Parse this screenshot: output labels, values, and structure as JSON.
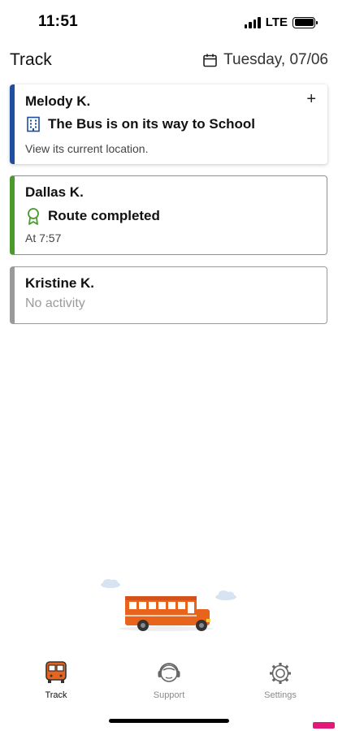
{
  "status_bar": {
    "time": "11:51",
    "network": "LTE"
  },
  "header": {
    "title": "Track",
    "date": "Tuesday, 07/06",
    "date_icon": "calendar-icon"
  },
  "cards": [
    {
      "name": "Melody K.",
      "status_icon": "building-icon",
      "headline": "The Bus is on its way to School",
      "detail": "View its current location.",
      "action": "+",
      "accent": "#1f4e9e"
    },
    {
      "name": "Dallas K.",
      "status_icon": "award-icon",
      "headline": "Route completed",
      "detail": "At 7:57",
      "accent": "#4a9a2c"
    },
    {
      "name": "Kristine K.",
      "detail": "No activity",
      "accent": "#9a9a9a"
    }
  ],
  "tabbar": {
    "items": [
      {
        "label": "Track",
        "icon": "bus-icon",
        "active": true
      },
      {
        "label": "Support",
        "icon": "headset-icon",
        "active": false
      },
      {
        "label": "Settings",
        "icon": "gear-icon",
        "active": false
      }
    ]
  },
  "colors": {
    "bus_orange": "#e8641c",
    "active_tab": "#111111",
    "inactive_tab": "#8a8a8a"
  }
}
